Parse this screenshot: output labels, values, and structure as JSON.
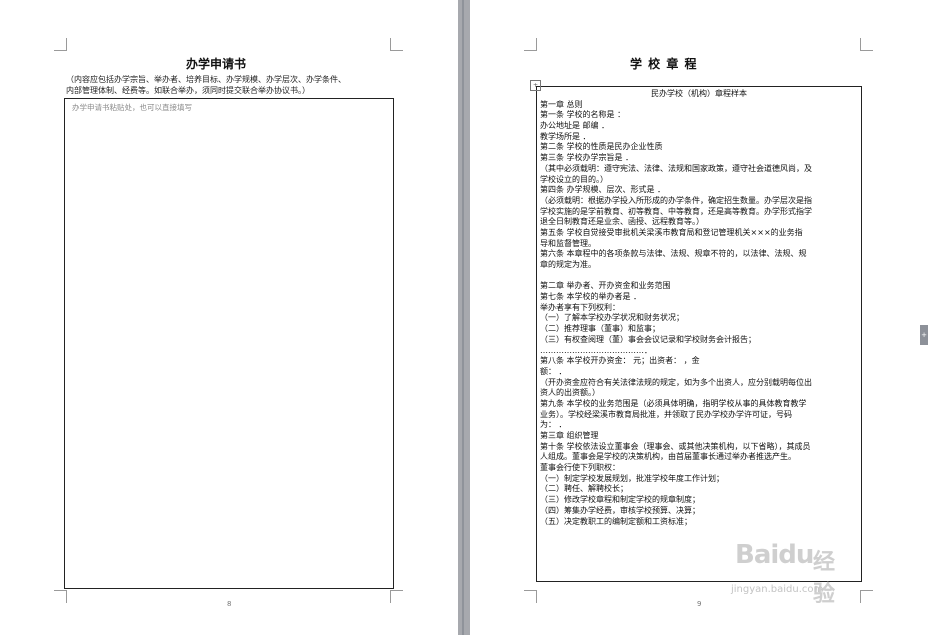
{
  "left_page": {
    "title": "办学申请书",
    "note_line1": "（内容应包括办学宗旨、举办者、培养目标、办学规模、办学层次、办学条件、",
    "note_line2": "内部管理体制、经费等。如联合举办，须同时提交联合举办协议书。）",
    "box_hint": "办学申请书粘贴处，也可以直接填写",
    "page_number": "8"
  },
  "right_page": {
    "title": "学 校 章 程",
    "page_number": "9",
    "lines": [
      "民办学校（机构）章程样本",
      "第一章   总则",
      "第一条   学校的名称是                                                   ：",
      "办公地址是                                              邮编                     ．",
      "教学场所是                                                                        ．",
      "第二条   学校的性质是民办企业性质",
      "第三条   学校办学宗旨是                                                      ．",
      "（其中必须载明：遵守宪法、法律、法规和国家政策，遵守社会道德风尚，及",
      "学校设立的目的。）",
      "第四条   办学规模、层次、形式是                                            ．",
      "（必须载明：根据办学投入所形成的办学条件，确定招生数量。办学层次是指",
      "学校实施的是学前教育、初等教育、中等教育，还是高等教育。办学形式指学",
      "退全日制教育还是业余、函授、远程教育等。）",
      "第五条   学校自觉接受审批机关梁溪市教育局和登记管理机关×××的业务指",
      "导和监督管理。",
      "第六条   本章程中的各项条款与法律、法规、规章不符的，以法律、法规、规",
      "章的规定为准。",
      "",
      "第二章   举办者、开办资金和业务范围",
      "第七条   本学校的举办者是                                                ．",
      "举办者享有下列权利：",
      "（一）了解本学校办学状况和财务状况；",
      "（二）推荐理事（董事）和监事；",
      "（三）有权查阅理（董）事会会议记录和学校财务会计报告；",
      "…………………………………．",
      "第八条    本学校开办资金：              元；出资者：              ，金",
      "额：                     ．",
      "（开办资金应符合有关法律法规的规定，如为多个出资人，应分别载明每位出",
      "资人的出资额。）",
      "第九条   本学校的业务范围是（必须具体明确，指明学校从事的具体教育教学",
      "业务）。学校经梁溪市教育局批准，并领取了民办学校办学许可证，号码",
      "为：                 ．",
      "第三章   组织管理",
      "第十条   学校依法设立董事会（理事会、或其他决策机构，以下省略），其成员",
      "     人组成。董事会是学校的决策机构，由首届董事长通过举办者推选产生。",
      "董事会行使下列职权：",
      "（一）制定学校发展规划，批准学校年度工作计划；",
      "（二）聘任、解聘校长；",
      "（三）修改学校章程和制定学校的规章制度；",
      "（四）筹集办学经费，审核学校预算、决算；",
      "（五）决定教职工的编制定额和工资标准；"
    ]
  },
  "watermark": {
    "logo": "Baidu",
    "cn": "经验",
    "url": "jingyan.baidu.com"
  },
  "side_tab_glyph": "+",
  "anchor_glyph": "+"
}
